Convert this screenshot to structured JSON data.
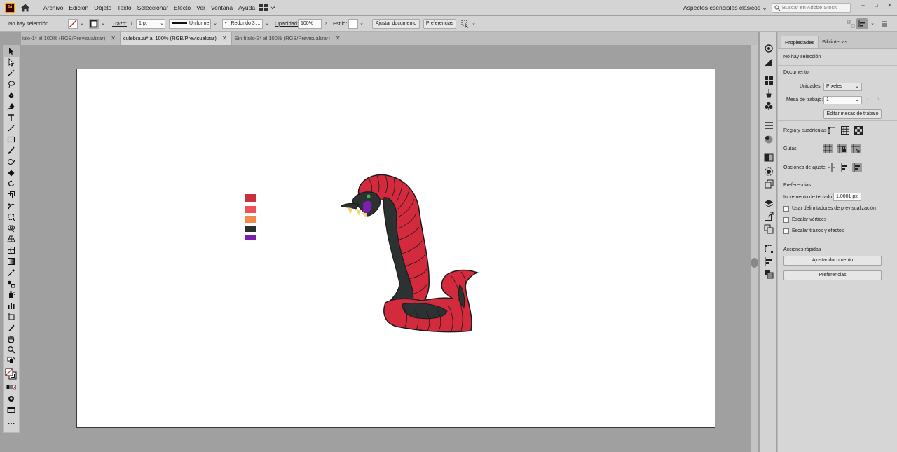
{
  "app": {
    "logo": "Ai"
  },
  "menu": {
    "items": [
      "Archivo",
      "Edición",
      "Objeto",
      "Texto",
      "Seleccionar",
      "Efecto",
      "Ver",
      "Ventana",
      "Ayuda"
    ]
  },
  "workspace": {
    "label": "Aspectos esenciales clásicos"
  },
  "stock_search": {
    "placeholder": "Buscar en Adobe Stock"
  },
  "window_controls": {
    "minimize": "–",
    "maximize": "□",
    "close": "✕"
  },
  "control_bar": {
    "selection_status": "No hay selección",
    "stroke_label": "Trazo:",
    "stroke_weight": "1 pt",
    "stroke_profile": "Uniforme",
    "brush": "Redondo 3 ...",
    "opacity_label": "Opacidad:",
    "opacity_value": "100%",
    "style_label": "Estilo:",
    "fit_document_button": "Ajustar documento",
    "preferences_button": "Preferencias"
  },
  "tabs": [
    {
      "label": "tulo-1* al 100% (RGB/Previsualizar)",
      "close": "✕",
      "active": false
    },
    {
      "label": "culebra.ai* al 100% (RGB/Previsualizar)",
      "close": "✕",
      "active": true
    },
    {
      "label": "Sin título-3* al 100% (RGB/Previsualizar)",
      "close": "✕",
      "active": false
    }
  ],
  "artwork": {
    "swatches": [
      "#c8303f",
      "#f0505a",
      "#f28a4a",
      "#2b2f30",
      "#7a1fb0"
    ],
    "snake_colors": {
      "body": "#d42a3e",
      "belly": "#2c3132",
      "fang": "#f2d46a",
      "eye": "#3bb34a",
      "mouth": "#7a1fb0"
    }
  },
  "panel": {
    "tabs": [
      "Propiedades",
      "Bibliotecas"
    ],
    "status": "No hay selección",
    "document": {
      "title": "Documento",
      "units_label": "Unidades:",
      "units_value": "Píxeles",
      "artboard_label": "Mesa de trabajo:",
      "artboard_value": "1",
      "edit_artboards_button": "Editar mesas de trabajo"
    },
    "rulers_label": "Regla y cuadrículas",
    "guides_label": "Guías",
    "snap_label": "Opciones de ajuste",
    "preferences": {
      "title": "Preferencias",
      "keyboard_increment_label": "Incremento de teclado:",
      "keyboard_increment_value": "1,0001 px",
      "options": [
        "Usar delimitadores de previsualización",
        "Escalar vértices",
        "Escalar trazos y efectos"
      ]
    },
    "quick_actions": {
      "title": "Acciones rápidas",
      "fit_document_button": "Ajustar documento",
      "preferences_button": "Preferencias"
    }
  }
}
